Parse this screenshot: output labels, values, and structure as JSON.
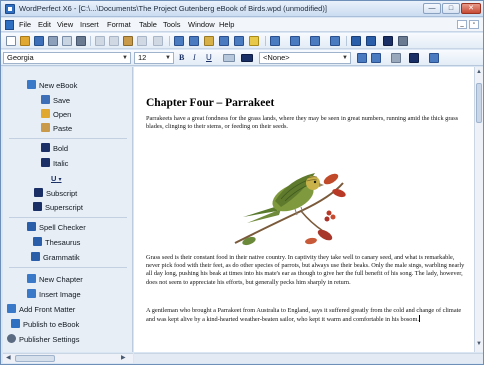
{
  "window": {
    "title": "WordPerfect X6 - [C:\\...\\Documents\\The Project Gutenberg eBook of Birds.wpd (unmodified)]",
    "minimize_label": "—",
    "maximize_label": "□",
    "close_label": "✕"
  },
  "menu": {
    "items": [
      "File",
      "Edit",
      "View",
      "Insert",
      "Format",
      "Table",
      "Tools",
      "Window",
      "Help"
    ],
    "minimize_doc": "_",
    "restore_doc": "▫"
  },
  "toolbar": {
    "font_name": "Georgia",
    "font_size": "12",
    "style": "<None>",
    "bold": "B",
    "italic": "I",
    "underline": "U"
  },
  "sidebar": {
    "items": [
      {
        "label": "New eBook",
        "icon": "new-ebook-icon",
        "color": "#3a78c8"
      },
      {
        "label": "Save",
        "icon": "save-icon",
        "color": "#3c6fb8"
      },
      {
        "label": "Open",
        "icon": "open-folder-icon",
        "color": "#e0a830"
      },
      {
        "label": "Paste",
        "icon": "paste-icon",
        "color": "#c99a4a"
      },
      {
        "label": "Bold",
        "icon": "bold-icon",
        "color": "#1a2f66"
      },
      {
        "label": "Italic",
        "icon": "italic-icon",
        "color": "#1a2f66"
      },
      {
        "label": "Subscript",
        "icon": "subscript-icon",
        "color": "#1a2f66"
      },
      {
        "label": "Superscript",
        "icon": "superscript-icon",
        "color": "#1a2f66"
      },
      {
        "label": "Spell Checker",
        "icon": "spell-checker-icon",
        "color": "#2a5ea8"
      },
      {
        "label": "Thesaurus",
        "icon": "thesaurus-icon",
        "color": "#2a5ea8"
      },
      {
        "label": "Grammatik",
        "icon": "grammatik-icon",
        "color": "#2a5ea8"
      },
      {
        "label": "New Chapter",
        "icon": "new-chapter-icon",
        "color": "#3a78c8"
      },
      {
        "label": "Insert Image",
        "icon": "insert-image-icon",
        "color": "#3a78c8"
      },
      {
        "label": "Add Front Matter",
        "icon": "add-front-matter-icon",
        "color": "#3a78c8"
      },
      {
        "label": "Publish to eBook",
        "icon": "publish-ebook-icon",
        "color": "#2f6fc1"
      },
      {
        "label": "Publisher Settings",
        "icon": "publisher-settings-icon",
        "color": "#5a6a80"
      }
    ],
    "underline_glyph": "U"
  },
  "document": {
    "chapter_title": "Chapter Four – Parrakeet",
    "paragraph1": "Parrakeets have a great fondness for the grass lands, where they may be seen in great numbers, running amid the thick grass blades, clinging to their stems, or feeding on their seeds.",
    "paragraph2": "Grass seed is their constant food in their native country. In captivity they take well to canary seed, and what is remarkable, never pick food with their feet, as do other species of parrots, but always use their beaks. Only the male sings, warbling nearly all day long, pushing his beak at times into his mate's ear as though to give her the full benefit of his song. The lady, however, does not seem to appreciate his efforts, but generally pecks him sharply in return.",
    "paragraph3": "A gentleman who brought a Parrakeet from Australia to England, says it suffered greatly from the cold and change of climate and was kept alive by a kind-hearted weather-beaten sailor, who kept it warm and comfortable in his bosom."
  },
  "colors": {
    "accent": "#2f6fc1",
    "bird_green": "#6f8a3a",
    "bird_yellow": "#c9b24a",
    "berry_red": "#b83a26"
  }
}
